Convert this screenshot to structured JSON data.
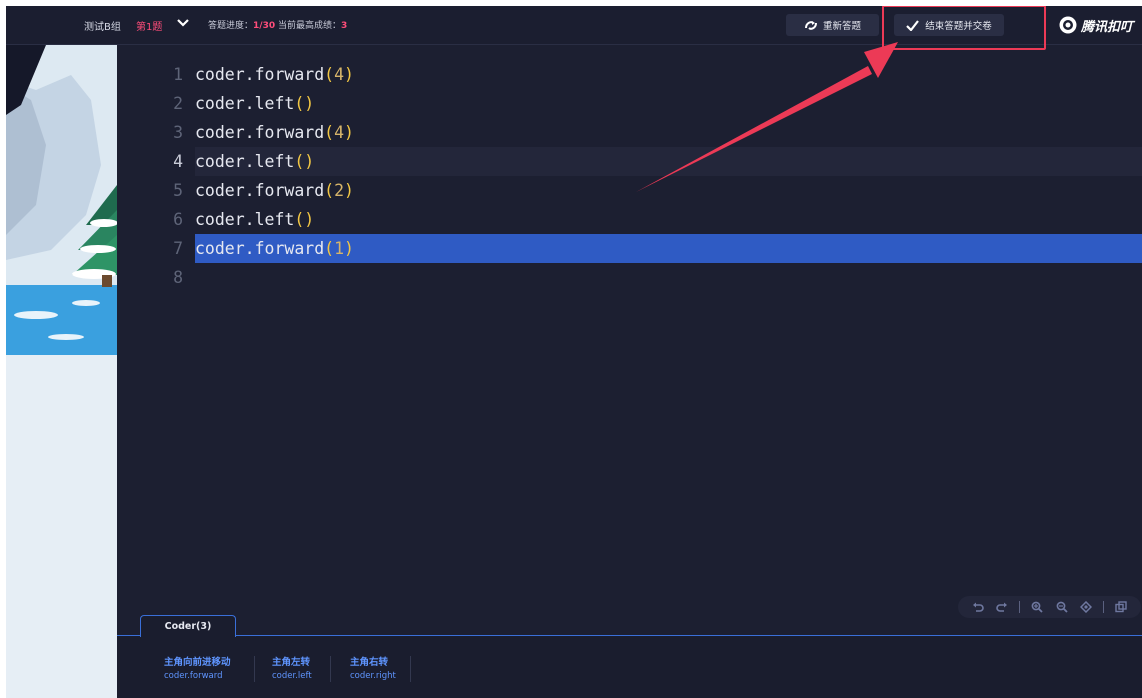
{
  "header": {
    "group": "测试B组",
    "question": "第1题",
    "progress_label": "答题进度：",
    "progress_value": "1/30",
    "best_label": "当前最高成绩：",
    "best_value": "3",
    "restart_label": "重新答题",
    "submit_label": "结束答题并交卷",
    "brand": "腾讯扣叮"
  },
  "editor": {
    "line_numbers": [
      "1",
      "2",
      "3",
      "4",
      "5",
      "6",
      "7",
      "8"
    ],
    "lines": [
      {
        "object": "coder",
        "method": ".forward",
        "arg": "4"
      },
      {
        "object": "coder",
        "method": ".left",
        "arg": ""
      },
      {
        "object": "coder",
        "method": ".forward",
        "arg": "4"
      },
      {
        "object": "coder",
        "method": ".left",
        "arg": ""
      },
      {
        "object": "coder",
        "method": ".forward",
        "arg": "2"
      },
      {
        "object": "coder",
        "method": ".left",
        "arg": ""
      },
      {
        "object": "coder",
        "method": ".forward",
        "arg": "1"
      },
      {
        "object": "",
        "method": "",
        "arg": ""
      }
    ],
    "current_line": "4",
    "selected_line": "7"
  },
  "toolbar_icons": [
    "undo-icon",
    "redo-icon",
    "zoom-in-icon",
    "zoom-out-icon",
    "center-icon",
    "copy-icon"
  ],
  "bottom": {
    "tab_label": "Coder(3)",
    "commands": [
      {
        "title": "主角向前进移动",
        "code": "coder.forward"
      },
      {
        "title": "主角左转",
        "code": "coder.left"
      },
      {
        "title": "主角右转",
        "code": "coder.right"
      }
    ]
  },
  "colors": {
    "background": "#1c1f31",
    "selection": "#2f5bc4",
    "accent_pink": "#ff4d7a",
    "command_blue": "#5f95ff",
    "annotation_red": "#ec3a56"
  }
}
